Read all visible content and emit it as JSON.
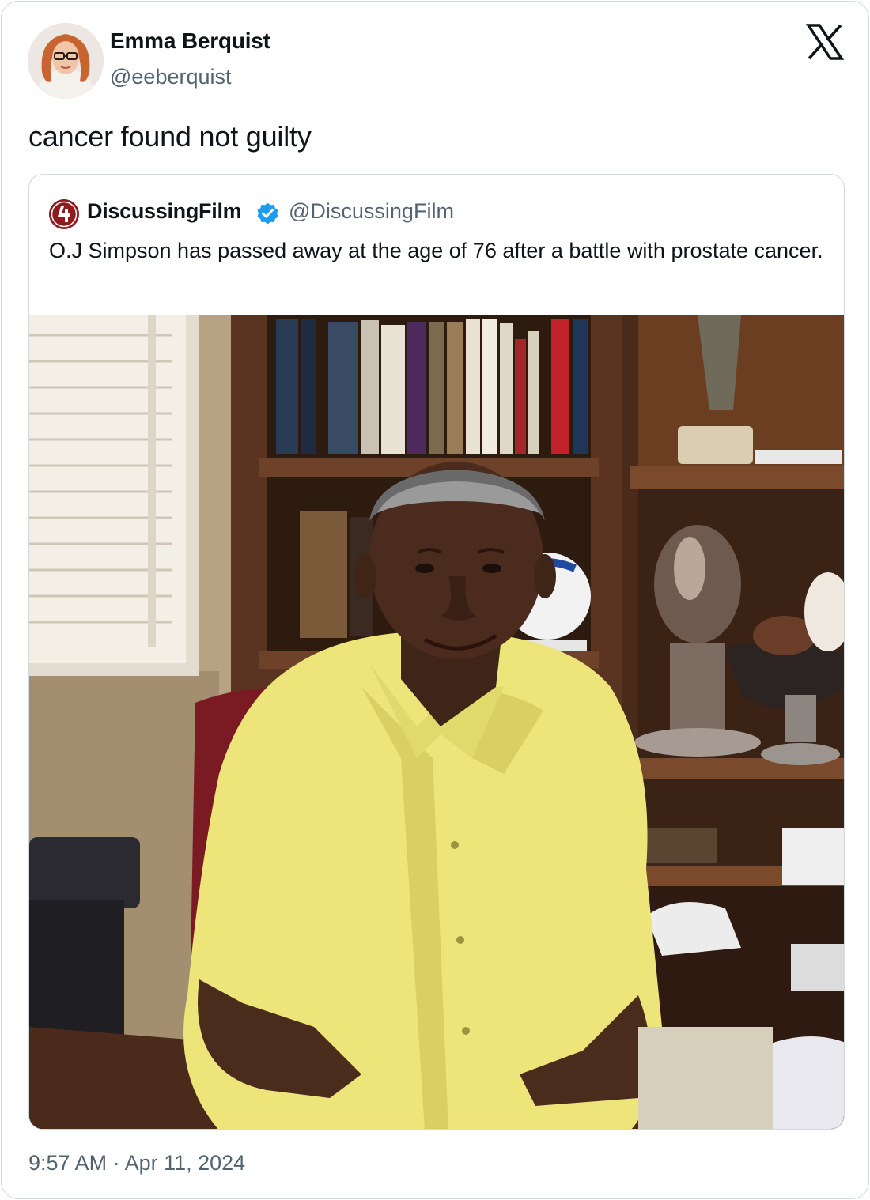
{
  "tweet": {
    "author_name": "Emma Berquist",
    "author_handle": "@eeberquist",
    "text": "cancer found not guilty",
    "timestamp": "9:57 AM · Apr 11, 2024"
  },
  "quoted_tweet": {
    "author_name": "DiscussingFilm",
    "author_handle": "@DiscussingFilm",
    "verified": true,
    "text": "O.J Simpson has passed away at the age of 76 after a battle with prostate cancer.",
    "photo": {
      "description": "Man in yellow shirt seated in front of bookshelves with trophies and footballs"
    }
  },
  "icons": {
    "platform": "x-logo-icon",
    "verified": "verified-badge-icon",
    "source_logo": "discussingfilm-logo-icon"
  },
  "colors": {
    "text_primary": "#0f1419",
    "text_secondary": "#536471",
    "border": "#cfd9de",
    "verified_blue": "#1d9bf0",
    "brand_red": "#8f1b1f"
  }
}
